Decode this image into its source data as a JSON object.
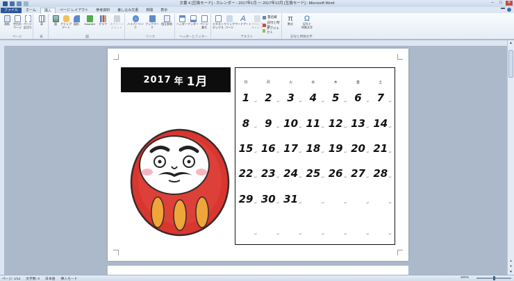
{
  "window": {
    "title": "文書 4 [互換モード] - カレンダー - 2017年1月 ～ 2017年12月 [互換モード] - Microsoft Word",
    "controls": [
      "–",
      "□",
      "✕"
    ]
  },
  "tabs": [
    {
      "label": "ファイル"
    },
    {
      "label": "ホーム"
    },
    {
      "label": "挿入"
    },
    {
      "label": "ページ レイアウト"
    },
    {
      "label": "参考資料"
    },
    {
      "label": "差し込み文書"
    },
    {
      "label": "校閲"
    },
    {
      "label": "表示"
    }
  ],
  "active_tab_index": 2,
  "ribbon": {
    "groups": {
      "page": "ページ",
      "table": "表",
      "illustration": "図",
      "link": "リンク",
      "header_footer": "ヘッダーとフッター",
      "text": "テキスト",
      "symbols": "記号と特殊文字"
    },
    "buttons": {
      "cover": "表紙",
      "blank_page": "空白の\nページ",
      "page_break": "ページ\n区切り",
      "table": "表",
      "picture": "図",
      "clipart": "クリップ\nアート",
      "shapes": "図形",
      "smartart": "SmartArt",
      "chart": "グラフ",
      "screenshot": "スクリーン\nショット",
      "hyperlink": "ハイパーリンク",
      "bookmark": "ブックマーク",
      "cross_ref": "相互参照",
      "header": "ヘッダー",
      "footer": "フッター",
      "page_number": "ページ\n番号",
      "quick_parts": "クイック\nパーツ",
      "textbox": "テキスト\nボックス",
      "wordart": "ワードアート",
      "dropcap": "ドロップ\nキャップ",
      "equation": "数式",
      "symbol": "記号と\n特殊文字"
    },
    "small": {
      "signature": "署名欄",
      "datetime": "日付と時刻",
      "object": "オブジェクト",
      "glance": "簡易表示"
    }
  },
  "document": {
    "month_year": "2017年",
    "month_kanji": "年",
    "month_number": "1月",
    "year_digits": "2017",
    "weekday_headers": [
      "日",
      "月",
      "火",
      "水",
      "木",
      "金",
      "土"
    ],
    "weeks": [
      [
        "1",
        "2",
        "3",
        "4",
        "5",
        "6",
        "7"
      ],
      [
        "8",
        "9",
        "10",
        "11",
        "12",
        "13",
        "14"
      ],
      [
        "15",
        "16",
        "17",
        "18",
        "19",
        "20",
        "21"
      ],
      [
        "22",
        "23",
        "24",
        "25",
        "26",
        "27",
        "28"
      ],
      [
        "29",
        "30",
        "31",
        "",
        "",
        "",
        ""
      ],
      [
        "",
        "",
        "",
        "",
        "",
        "",
        ""
      ]
    ],
    "colors": {
      "daruma_red": "#d8362f",
      "daruma_gold": "#f0a53a",
      "cheek_pink": "#f4b7c0"
    }
  },
  "status": {
    "page": "ページ: 1/12",
    "words": "文字数: 0",
    "lang": "日本語",
    "mode": "挿入モード",
    "zoom": "100%"
  }
}
